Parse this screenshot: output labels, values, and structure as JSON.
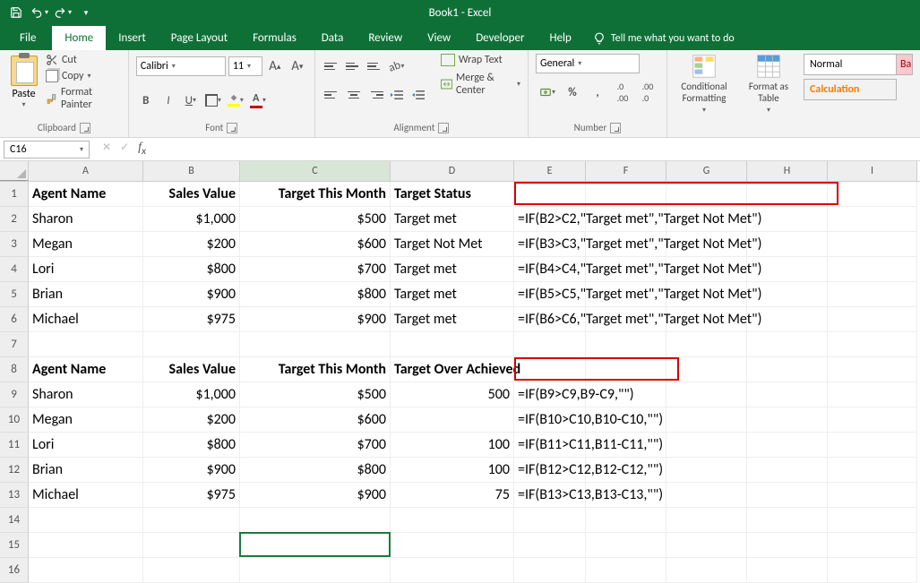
{
  "title": "Book1 - Excel",
  "tabs": [
    "File",
    "Home",
    "Insert",
    "Page Layout",
    "Formulas",
    "Data",
    "Review",
    "View",
    "Developer",
    "Help"
  ],
  "tellme": "Tell me what you want to do",
  "clipboard": {
    "paste": "Paste",
    "cut": "Cut",
    "copy": "Copy",
    "fmt": "Format Painter",
    "label": "Clipboard"
  },
  "font": {
    "name": "Calibri",
    "size": "11",
    "label": "Font"
  },
  "alignment": {
    "wrap": "Wrap Text",
    "merge": "Merge & Center",
    "label": "Alignment"
  },
  "number": {
    "format": "General",
    "label": "Number"
  },
  "condfmt": "Conditional Formatting",
  "fmttable": "Format as Table",
  "styles": {
    "normal": "Normal",
    "calc": "Calculation",
    "bad": "Ba"
  },
  "namebox": "C16",
  "columns": [
    "A",
    "B",
    "C",
    "D",
    "E",
    "F",
    "G",
    "H",
    "I"
  ],
  "rows": [
    {
      "n": "1",
      "A": "Agent Name",
      "B": "Sales Value",
      "C": "Target This Month",
      "D": "Target Status",
      "bold": true
    },
    {
      "n": "2",
      "A": "Sharon",
      "B": "$1,000",
      "C": "$500",
      "D": "Target met",
      "E": "=IF(B2>C2,\"Target met\",\"Target Not Met\")"
    },
    {
      "n": "3",
      "A": "Megan",
      "B": "$200",
      "C": "$600",
      "D": "Target Not Met",
      "E": "=IF(B3>C3,\"Target met\",\"Target Not Met\")"
    },
    {
      "n": "4",
      "A": "Lori",
      "B": "$800",
      "C": "$700",
      "D": "Target met",
      "E": "=IF(B4>C4,\"Target met\",\"Target Not Met\")"
    },
    {
      "n": "5",
      "A": "Brian",
      "B": "$900",
      "C": "$800",
      "D": "Target met",
      "E": "=IF(B5>C5,\"Target met\",\"Target Not Met\")"
    },
    {
      "n": "6",
      "A": "Michael",
      "B": "$975",
      "C": "$900",
      "D": "Target met",
      "E": "=IF(B6>C6,\"Target met\",\"Target Not Met\")"
    },
    {
      "n": "7"
    },
    {
      "n": "8",
      "A": "Agent Name",
      "B": "Sales Value",
      "C": "Target This Month",
      "D": "Target Over Achieved",
      "bold": true
    },
    {
      "n": "9",
      "A": "Sharon",
      "B": "$1,000",
      "C": "$500",
      "D": "500",
      "E": "=IF(B9>C9,B9-C9,\"\")"
    },
    {
      "n": "10",
      "A": "Megan",
      "B": "$200",
      "C": "$600",
      "D": "",
      "E": "=IF(B10>C10,B10-C10,\"\")"
    },
    {
      "n": "11",
      "A": "Lori",
      "B": "$800",
      "C": "$700",
      "D": "100",
      "E": "=IF(B11>C11,B11-C11,\"\")"
    },
    {
      "n": "12",
      "A": "Brian",
      "B": "$900",
      "C": "$800",
      "D": "100",
      "E": "=IF(B12>C12,B12-C12,\"\")"
    },
    {
      "n": "13",
      "A": "Michael",
      "B": "$975",
      "C": "$900",
      "D": "75",
      "E": "=IF(B13>C13,B13-C13,\"\")"
    }
  ]
}
